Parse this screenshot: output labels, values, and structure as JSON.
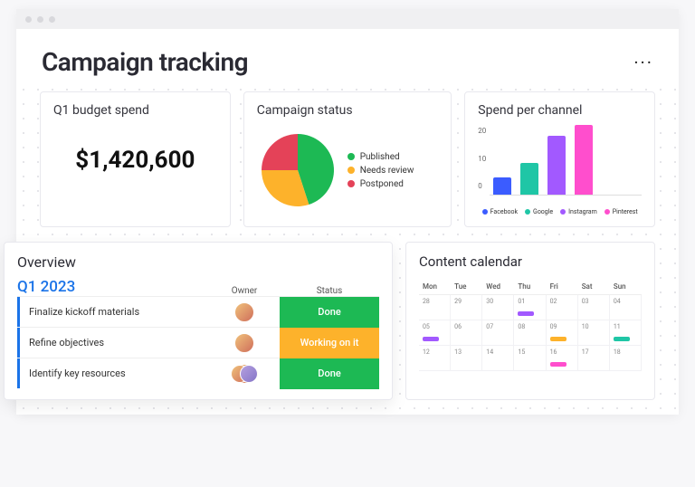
{
  "header": {
    "title": "Campaign tracking"
  },
  "budget": {
    "title": "Q1 budget spend",
    "value": "$1,420,600"
  },
  "status": {
    "title": "Campaign status",
    "legend": [
      {
        "label": "Published",
        "color": "#1db954"
      },
      {
        "label": "Needs review",
        "color": "#fdb22b"
      },
      {
        "label": "Postponed",
        "color": "#e44258"
      }
    ]
  },
  "spend": {
    "title": "Spend per channel",
    "yticks": [
      "20",
      "10",
      "0"
    ],
    "legend": [
      {
        "label": "Facebook",
        "color": "#3b5cff"
      },
      {
        "label": "Google",
        "color": "#1fc6a6"
      },
      {
        "label": "Instagram",
        "color": "#a259ff"
      },
      {
        "label": "Pinterest",
        "color": "#ff4ecd"
      }
    ]
  },
  "overview": {
    "title": "Overview",
    "period": "Q1 2023",
    "cols": {
      "owner": "Owner",
      "status": "Status"
    },
    "tasks": [
      {
        "name": "Finalize kickoff materials",
        "owner_count": 1,
        "status_label": "Done",
        "status_color": "#1db954"
      },
      {
        "name": "Refine objectives",
        "owner_count": 1,
        "status_label": "Working on it",
        "status_color": "#fdb22b"
      },
      {
        "name": "Identify key resources",
        "owner_count": 2,
        "status_label": "Done",
        "status_color": "#1db954"
      }
    ]
  },
  "calendar": {
    "title": "Content calendar",
    "days": [
      "Mon",
      "Tue",
      "Wed",
      "Thu",
      "Fri",
      "Sat",
      "Sun"
    ],
    "weeks": [
      [
        {
          "d": "28"
        },
        {
          "d": "29"
        },
        {
          "d": "30"
        },
        {
          "d": "01",
          "ev": "#a259ff"
        },
        {
          "d": "02"
        },
        {
          "d": "03"
        },
        {
          "d": "04"
        }
      ],
      [
        {
          "d": "05",
          "ev": "#a259ff"
        },
        {
          "d": "06"
        },
        {
          "d": "07"
        },
        {
          "d": "08"
        },
        {
          "d": "09",
          "ev": "#fdb22b"
        },
        {
          "d": "10"
        },
        {
          "d": "11",
          "ev": "#1fc6a6"
        }
      ],
      [
        {
          "d": "12"
        },
        {
          "d": "13"
        },
        {
          "d": "14"
        },
        {
          "d": "15"
        },
        {
          "d": "16",
          "ev": "#ff4ecd"
        },
        {
          "d": "17"
        },
        {
          "d": "18"
        }
      ]
    ]
  },
  "chart_data": [
    {
      "type": "pie",
      "title": "Campaign status",
      "series": [
        {
          "name": "Published",
          "value": 45,
          "color": "#1db954"
        },
        {
          "name": "Needs review",
          "value": 30,
          "color": "#fdb22b"
        },
        {
          "name": "Postponed",
          "value": 25,
          "color": "#e44258"
        }
      ]
    },
    {
      "type": "bar",
      "title": "Spend per channel",
      "ylabel": "",
      "ylim": [
        0,
        20
      ],
      "categories": [
        "Facebook",
        "Google",
        "Instagram",
        "Pinterest"
      ],
      "series": [
        {
          "name": "Facebook",
          "values": [
            5
          ],
          "color": "#3b5cff"
        },
        {
          "name": "Google",
          "values": [
            9
          ],
          "color": "#1fc6a6"
        },
        {
          "name": "Instagram",
          "values": [
            17
          ],
          "color": "#a259ff"
        },
        {
          "name": "Pinterest",
          "values": [
            20
          ],
          "color": "#ff4ecd"
        }
      ]
    }
  ]
}
